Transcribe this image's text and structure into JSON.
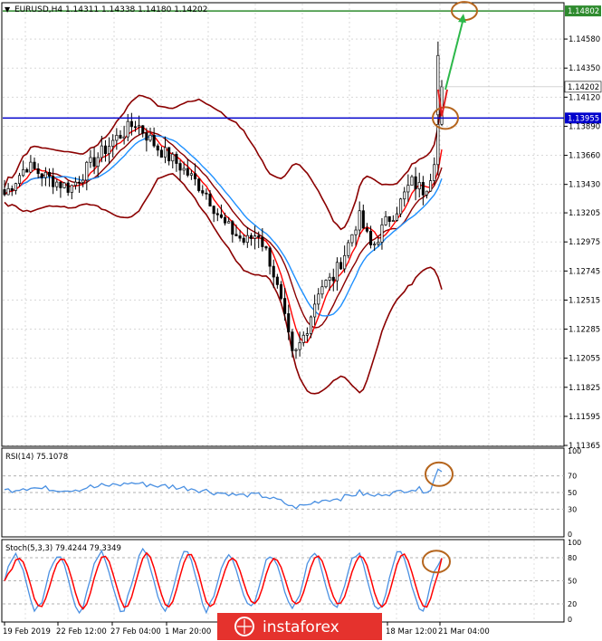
{
  "header": {
    "symbol_line": "EURUSD,H4  1.14311 1.14338 1.14180 1.14202"
  },
  "chart_data": {
    "type": "candlestick",
    "symbol": "EURUSD",
    "timeframe": "H4",
    "ohlc_header": {
      "open": 1.14311,
      "high": 1.14338,
      "low": 1.1418,
      "close": 1.14202
    },
    "price_axis": {
      "ticks": [
        "1.14580",
        "1.14350",
        "1.14120",
        "1.13890",
        "1.13660",
        "1.13430",
        "1.13205",
        "1.12975",
        "1.12745",
        "1.12515",
        "1.12285",
        "1.12055",
        "1.11825",
        "1.11595",
        "1.11365"
      ],
      "range": [
        1.11365,
        1.1486
      ]
    },
    "time_axis": {
      "labels": [
        "19 Feb 2019",
        "22 Feb 12:00",
        "27 Feb 04:00",
        "1 Mar 20:00",
        "18 Mar 12:00",
        "21 Mar 04:00"
      ]
    },
    "horizontal_levels": [
      {
        "label": "1.14802",
        "value": 1.14802,
        "color": "#2e8b2e"
      },
      {
        "label": "1.13955",
        "value": 1.13955,
        "color": "#0000cc"
      }
    ],
    "current_price": {
      "label": "1.14202",
      "value": 1.14202
    },
    "series": {
      "candles_key": [
        [
          0,
          1.1335
        ],
        [
          0.05,
          1.1358
        ],
        [
          0.1,
          1.1348
        ],
        [
          0.15,
          1.134
        ],
        [
          0.2,
          1.136
        ],
        [
          0.25,
          1.1378
        ],
        [
          0.3,
          1.1392
        ],
        [
          0.35,
          1.1372
        ],
        [
          0.4,
          1.1358
        ],
        [
          0.46,
          1.1337
        ],
        [
          0.5,
          1.1312
        ],
        [
          0.55,
          1.1297
        ],
        [
          0.58,
          1.1305
        ],
        [
          0.61,
          1.128
        ],
        [
          0.635,
          1.1245
        ],
        [
          0.66,
          1.1204
        ],
        [
          0.69,
          1.1228
        ],
        [
          0.72,
          1.1262
        ],
        [
          0.75,
          1.1268
        ],
        [
          0.78,
          1.129
        ],
        [
          0.81,
          1.1318
        ],
        [
          0.84,
          1.1292
        ],
        [
          0.87,
          1.1312
        ],
        [
          0.9,
          1.1325
        ],
        [
          0.93,
          1.1345
        ],
        [
          0.96,
          1.1338
        ],
        [
          0.98,
          1.1356
        ],
        [
          0.99,
          1.1385
        ],
        [
          1.0,
          1.142
        ]
      ]
    },
    "indicators": [
      {
        "name": "RSI(14)",
        "value": 75.1078,
        "label": "RSI(14) 75.1078",
        "levels": [
          70,
          50,
          30
        ],
        "range": [
          0,
          100
        ],
        "axis_ticks": [
          "100",
          "70",
          "50",
          "30",
          "0"
        ]
      },
      {
        "name": "Stoch(5,3,3)",
        "main": 79.4244,
        "signal": 79.3349,
        "label": "Stoch(5,3,3) 79.4244 79.3349",
        "levels": [
          80,
          50,
          20
        ],
        "range": [
          0,
          100
        ],
        "axis_ticks": [
          "100",
          "80",
          "50",
          "20",
          "0"
        ]
      }
    ],
    "annotations": [
      "circle at price 1.14802 target",
      "circle at 1.13955 breakout",
      "green arrow up to target",
      "red arrow pullback to 1.13955"
    ]
  },
  "watermark": "instaforex",
  "colors": {
    "candle": "#000000",
    "bull_body": "#ffffff",
    "bear_body": "#000000",
    "bb": "#8b0000",
    "ma_fast": "#ff0000",
    "ma_slow": "#1e90ff",
    "rsi": "#4a90e2",
    "stoch_main": "#4a90e2",
    "stoch_signal": "#ff0000",
    "circle": "#b5651d",
    "green_arrow": "#2db84a",
    "red_arrow": "#e02020",
    "watermark_bg": "#e5322d"
  }
}
